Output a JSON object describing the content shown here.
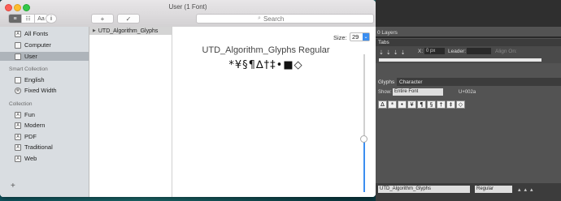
{
  "window": {
    "title": "User (1 Font)"
  },
  "toolbar": {
    "view_buttons": [
      "≡",
      "☷",
      "Aa"
    ],
    "add_label": "+",
    "validate_label": "✓",
    "search_placeholder": "Search"
  },
  "sidebar": {
    "library_items": [
      {
        "label": "All Fonts",
        "icon": "font-library-icon"
      },
      {
        "label": "Computer",
        "icon": "computer-icon"
      },
      {
        "label": "User",
        "icon": "user-fonts-icon"
      }
    ],
    "smart_header": "Smart Collection",
    "smart_items": [
      {
        "label": "English",
        "icon": "english-icon"
      },
      {
        "label": "Fixed Width",
        "icon": "gear-icon"
      }
    ],
    "collection_header": "Collection",
    "collection_items": [
      {
        "label": "Fun"
      },
      {
        "label": "Modern"
      },
      {
        "label": "PDF"
      },
      {
        "label": "Traditional"
      },
      {
        "label": "Web"
      }
    ],
    "add_label": "+"
  },
  "family_list": {
    "items": [
      "UTD_Algorithm_Glyphs"
    ]
  },
  "preview": {
    "size_label": "Size:",
    "size_value": "29",
    "font_name": "UTD_Algorithm_Glyphs Regular",
    "glyphs": "*¥§¶∆†‡•■◇"
  },
  "adobe": {
    "layers_label": "0 Layers",
    "tabs_label": "Tabs",
    "x_label": "X:",
    "x_value": "0 px",
    "leader_label": "Leader:",
    "align_label": "Align On:",
    "glyphs_tab": "Glyphs",
    "character_tab": "Character",
    "show_label": "Show:",
    "show_value": "Entire Font",
    "unicode": "U+002a",
    "glyph_cells": [
      "∆",
      "*",
      "•",
      "¥",
      "¶",
      "§",
      "†",
      "‡",
      "◇"
    ],
    "font_value": "UTD_Algorithm_Glyphs",
    "style_value": "Regular"
  }
}
